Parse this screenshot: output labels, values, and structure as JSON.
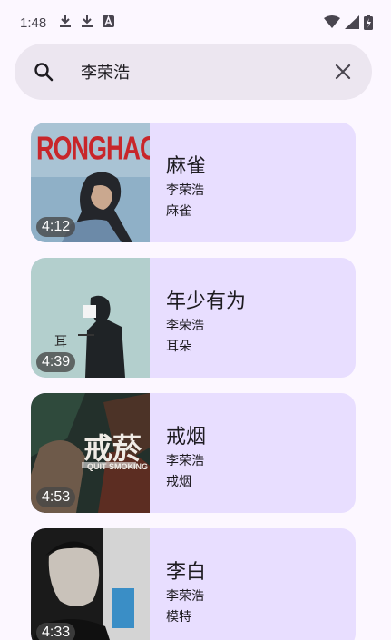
{
  "status_bar": {
    "time": "1:48",
    "icons": [
      "download-icon",
      "download-icon",
      "text-a-icon",
      "wifi-icon",
      "signal-icon",
      "battery-icon"
    ]
  },
  "search": {
    "query": "李荣浩",
    "icon": "search-icon",
    "clear_icon": "close-icon"
  },
  "results": [
    {
      "title": "麻雀",
      "artist": "李荣浩",
      "album": "麻雀",
      "duration": "4:12",
      "thumb_text": "RONGHAO"
    },
    {
      "title": "年少有为",
      "artist": "李荣浩",
      "album": "耳朵",
      "duration": "4:39",
      "thumb_text": "耳"
    },
    {
      "title": "戒烟",
      "artist": "李荣浩",
      "album": "戒烟",
      "duration": "4:53",
      "thumb_text": "戒菸",
      "thumb_subtext": "QUIT SMOKING"
    },
    {
      "title": "李白",
      "artist": "李荣浩",
      "album": "模特",
      "duration": "4:33"
    }
  ],
  "colors": {
    "background": "#fcf7ff",
    "search_bar": "#ece6f0",
    "card": "#e8deff",
    "text": "#1d1b20"
  }
}
